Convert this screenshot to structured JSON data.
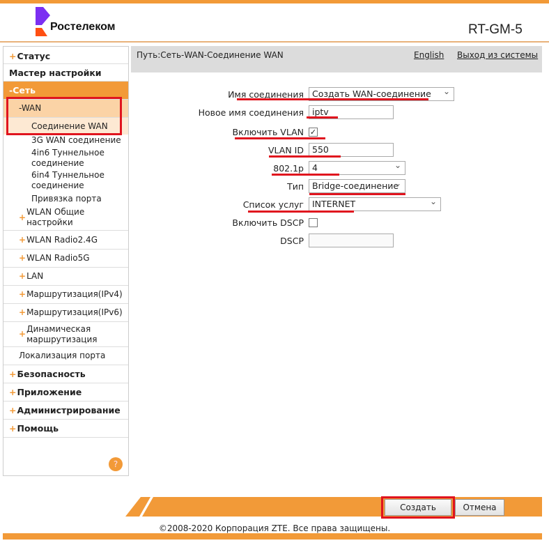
{
  "header": {
    "brand": "Ростелеком",
    "model": "RT-GM-5",
    "brand_color": "#7b2ff2",
    "accent": "#f29a38"
  },
  "path": {
    "text": "Путь:Сеть-WAN-Соединение WAN",
    "language": "English",
    "logout": "Выход из системы"
  },
  "sidebar": {
    "items": [
      {
        "label": "Статус",
        "plus": "+"
      },
      {
        "label": "Мастер настройки"
      },
      {
        "label": "-Сеть"
      },
      {
        "label": "-WAN"
      },
      {
        "label": "Соединение WAN"
      },
      {
        "label": "3G WAN соединение"
      },
      {
        "label": "4in6 Туннельное соединение"
      },
      {
        "label": "6in4 Туннельное соединение"
      },
      {
        "label": "Привязка порта"
      },
      {
        "label": "WLAN Общие настройки",
        "plus": "+"
      },
      {
        "label": "WLAN Radio2.4G",
        "plus": "+"
      },
      {
        "label": "WLAN Radio5G",
        "plus": "+"
      },
      {
        "label": "LAN",
        "plus": "+"
      },
      {
        "label": "Маршрутизация(IPv4)",
        "plus": "+"
      },
      {
        "label": "Маршрутизация(IPv6)",
        "plus": "+"
      },
      {
        "label": "Динамическая маршрутизация",
        "plus": "+"
      },
      {
        "label": "Локализация порта"
      },
      {
        "label": "Безопасность",
        "plus": "+"
      },
      {
        "label": "Приложение",
        "plus": "+"
      },
      {
        "label": "Администрирование",
        "plus": "+"
      },
      {
        "label": "Помощь",
        "plus": "+"
      }
    ],
    "help": "?"
  },
  "form": {
    "conn_name_label": "Имя соединения",
    "conn_name_value": "Создать WAN-соединение",
    "new_name_label": "Новое имя соединения",
    "new_name_value": "iptv",
    "vlan_enable_label": "Включить VLAN",
    "vlan_enable_checked": true,
    "check": "✓",
    "vlan_id_label": "VLAN ID",
    "vlan_id_value": "550",
    "p8021_label": "802.1p",
    "p8021_value": "4",
    "type_label": "Тип",
    "type_value": "Bridge-соединение",
    "services_label": "Список услуг",
    "services_value": "INTERNET",
    "dscp_enable_label": "Включить DSCP",
    "dscp_enable_checked": false,
    "dscp_label": "DSCP",
    "dscp_value": ""
  },
  "buttons": {
    "create": "Создать",
    "cancel": "Отмена"
  },
  "footer": {
    "copyright": "©2008-2020 Корпорация ZTE. Все права защищены."
  }
}
